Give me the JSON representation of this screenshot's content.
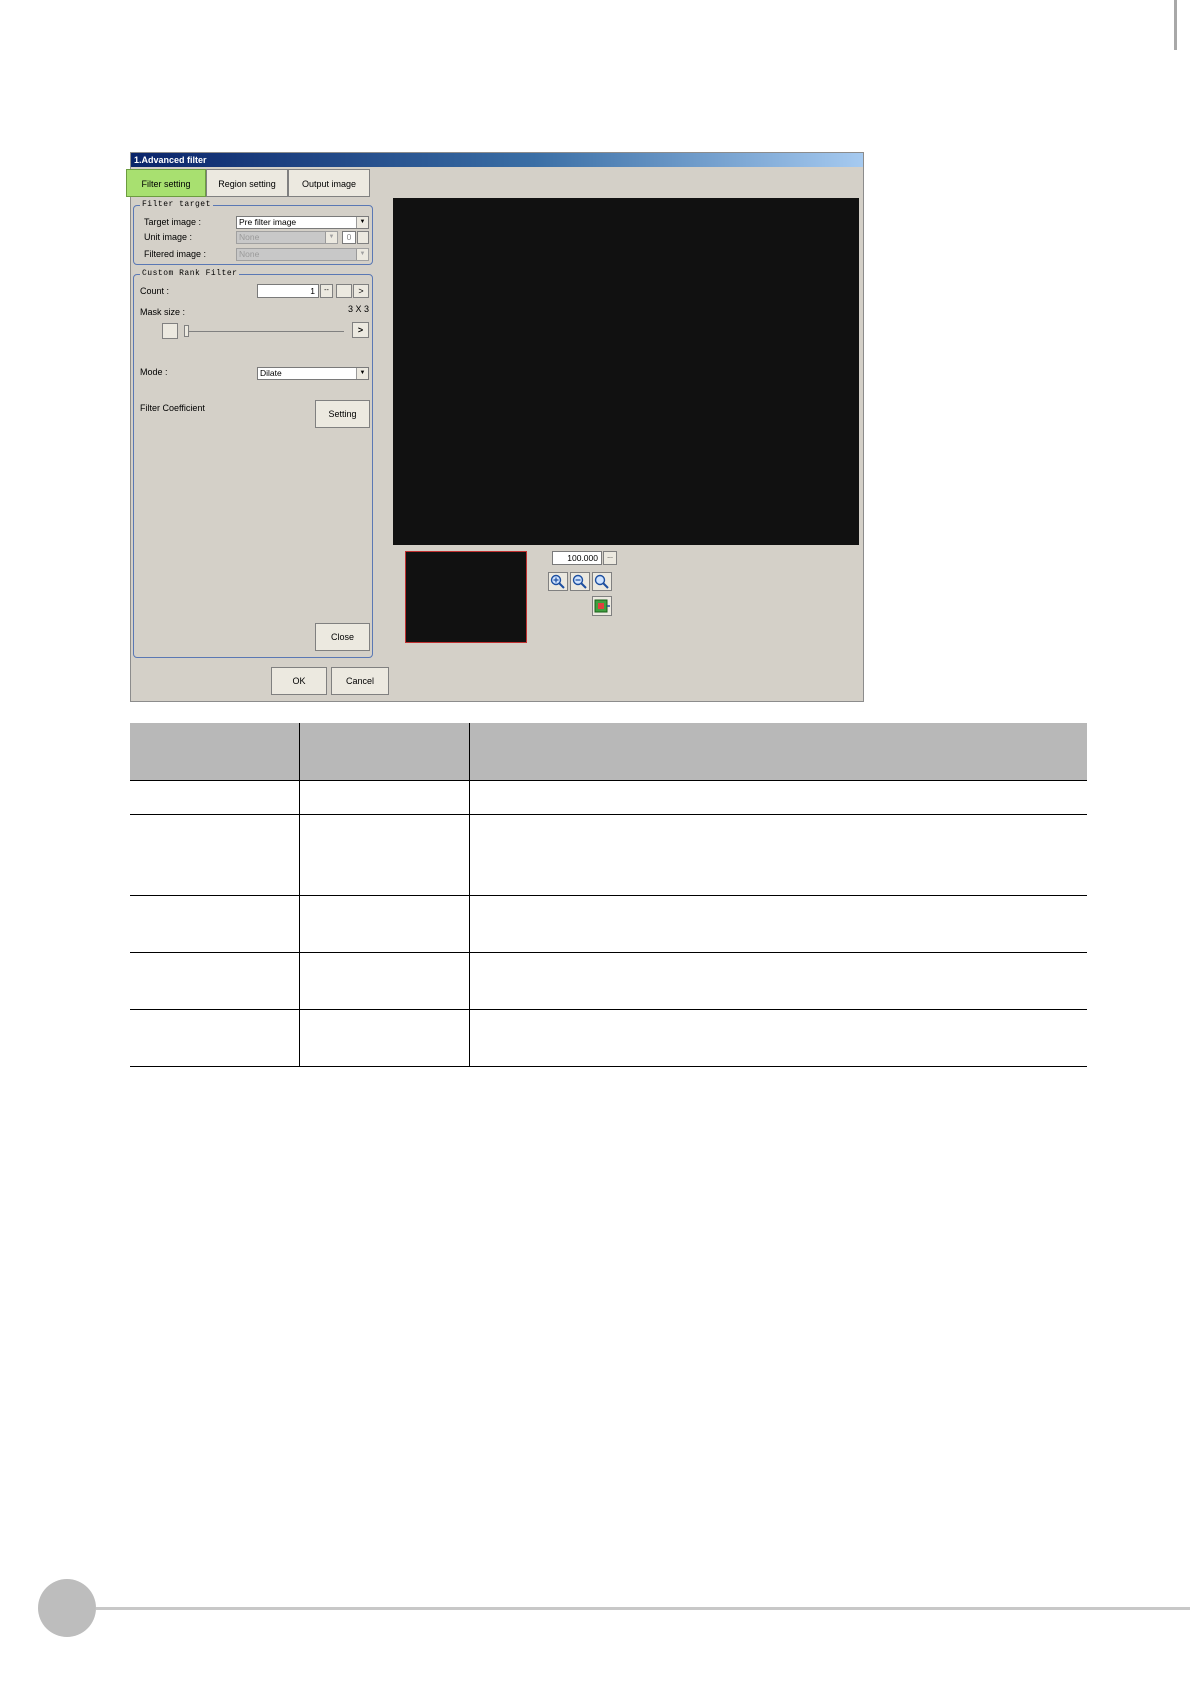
{
  "window": {
    "title": "1.Advanced filter"
  },
  "tabs": [
    {
      "label": "Filter setting",
      "active": true
    },
    {
      "label": "Region setting",
      "active": false
    },
    {
      "label": "Output image",
      "active": false
    }
  ],
  "filter_target": {
    "legend": "Filter target",
    "target_image": {
      "label": "Target image :",
      "value": "Pre filter image"
    },
    "unit_image": {
      "label": "Unit image :",
      "value": "None",
      "number": "0"
    },
    "filtered_image": {
      "label": "Filtered image :",
      "value": "None"
    }
  },
  "custom_rank_filter": {
    "legend": "Custom Rank Filter",
    "count": {
      "label": "Count :",
      "value": "1",
      "minus": "--",
      "plus": ">"
    },
    "mask_size": {
      "label": "Mask size :",
      "value": "3 X 3",
      "plus": ">",
      "level": 0
    },
    "mode": {
      "label": "Mode :",
      "value": "Dilate"
    },
    "filter_coefficient": {
      "label": "Filter Coefficient",
      "button": "Setting"
    },
    "close_button": "Close"
  },
  "dialog_buttons": {
    "ok": "OK",
    "cancel": "Cancel"
  },
  "zoom": {
    "value": "100.000",
    "dots": "..."
  },
  "colors": {
    "active_tab": "#a8e070",
    "group_border": "#5a78b4",
    "table_header": "#b8b8b8",
    "viewer": "#111111"
  }
}
